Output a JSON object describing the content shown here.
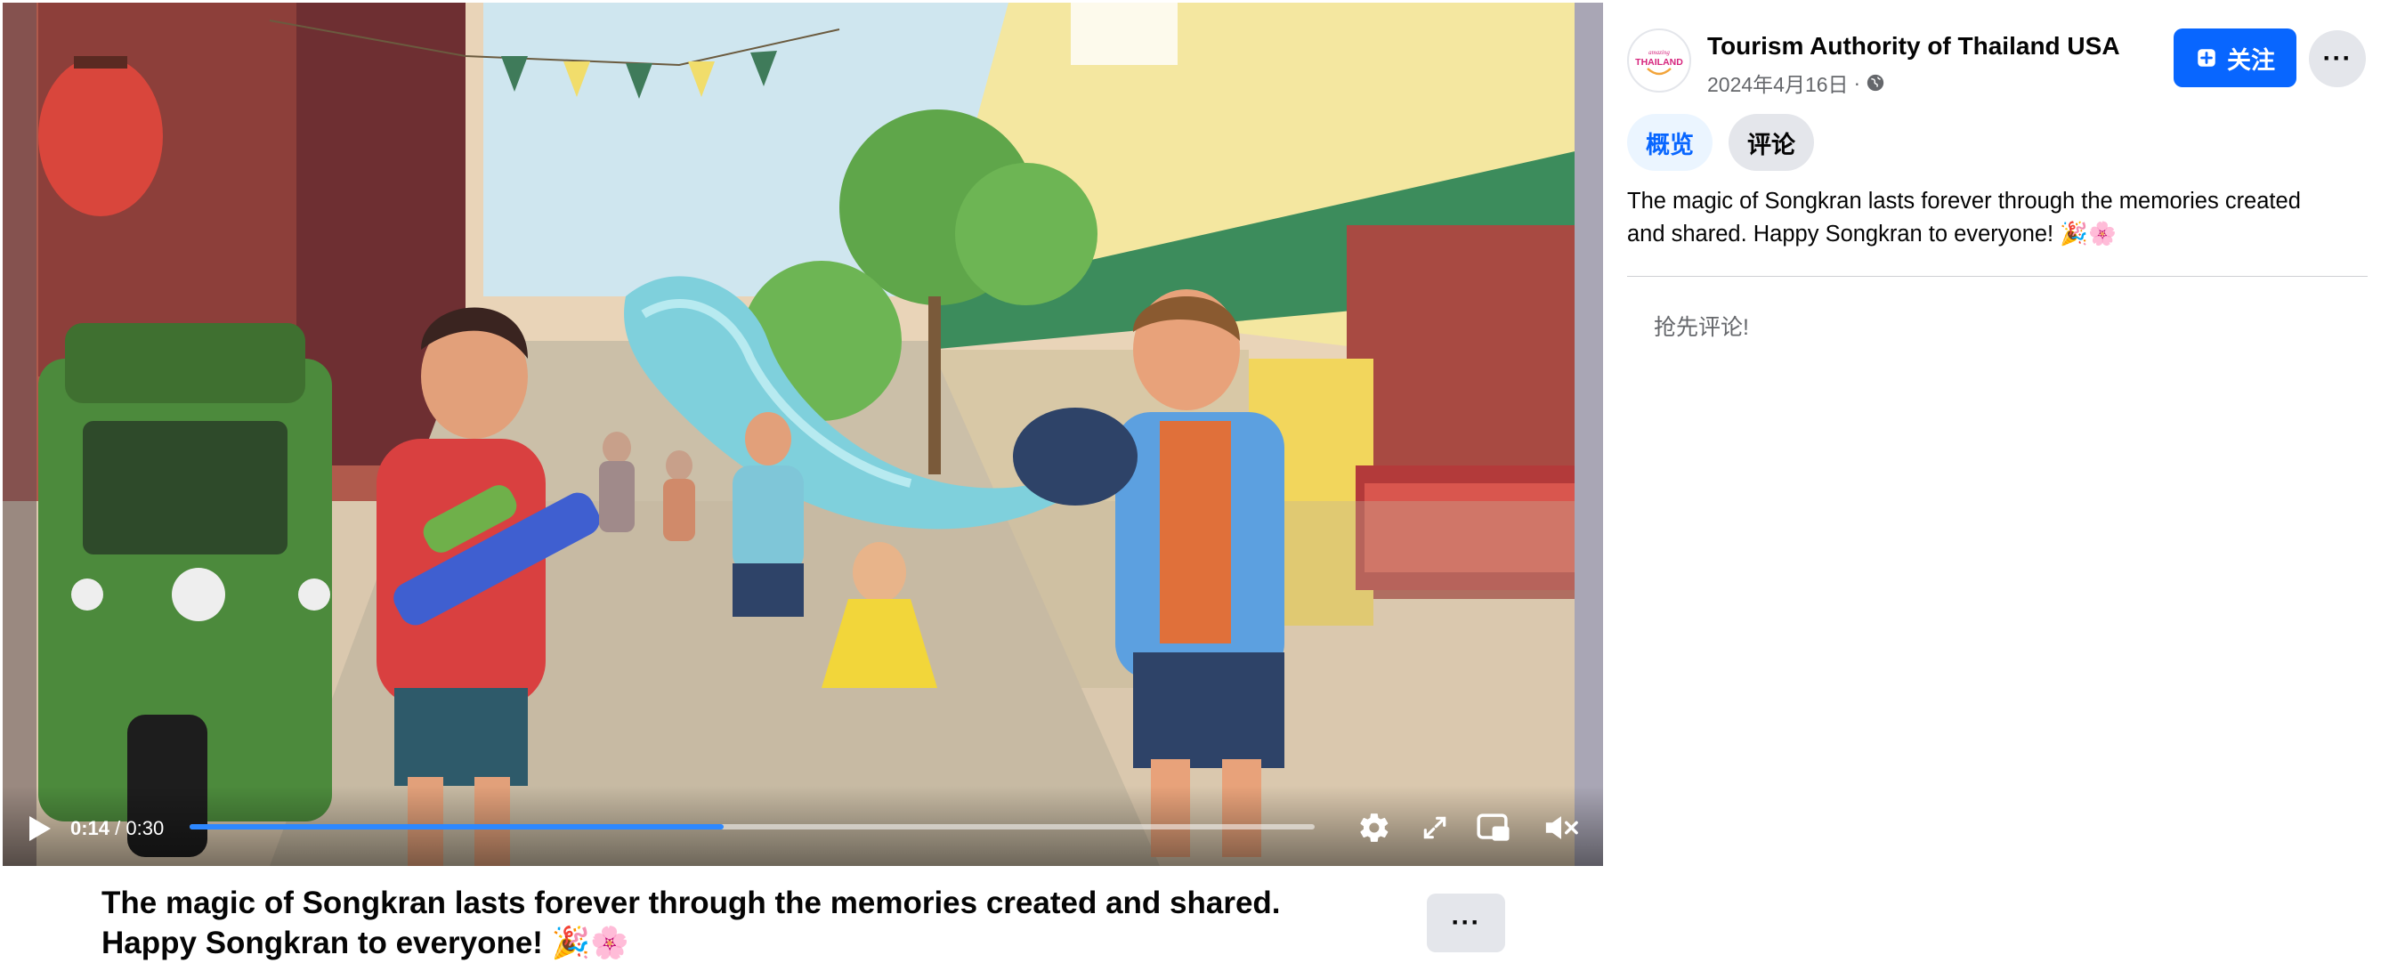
{
  "player": {
    "current_time": "0:14",
    "duration": "0:30",
    "progress_fraction": 0.475,
    "muted": true
  },
  "caption": {
    "line1": "The magic of Songkran lasts forever through the memories created and shared.",
    "line2": "Happy Songkran to everyone! 🎉🌸",
    "more_label": "···"
  },
  "post": {
    "page_name": "Tourism Authority of Thailand USA",
    "date": "2024年4月16日",
    "separator": "·",
    "audience_icon": "globe-icon",
    "follow_label": "关注",
    "more_label": "···",
    "tabs": [
      "概览",
      "评论"
    ],
    "description_line1": "The magic of Songkran lasts forever through the memories created",
    "description_line2": "and shared. Happy Songkran to everyone! 🎉🌸",
    "comment_prompt": "抢先评论!"
  },
  "logo": {
    "small_text": "amazing",
    "main_text": "THAILAND"
  },
  "colors": {
    "accent": "#0866ff",
    "progress": "#2d88ff",
    "tab_active_bg": "#ebf5ff",
    "secondary_text": "#65676b",
    "logo_pink": "#d6247d"
  }
}
